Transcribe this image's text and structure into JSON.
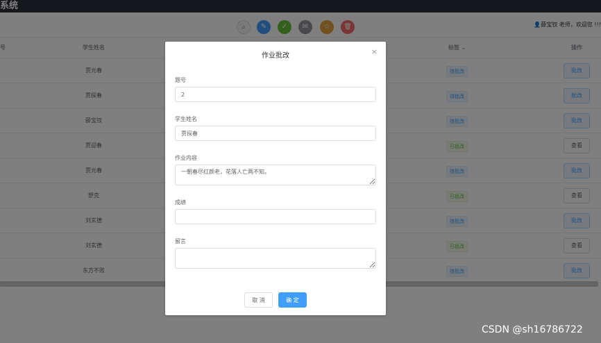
{
  "header": {
    "title": "系统"
  },
  "toolbar": {
    "buttons": [
      {
        "icon": "search-icon",
        "glyph": "⌕",
        "color": "#f5f5f5"
      },
      {
        "icon": "edit-icon",
        "glyph": "✎",
        "color": "#409eff"
      },
      {
        "icon": "check-icon",
        "glyph": "✓",
        "color": "#67c23a"
      },
      {
        "icon": "mail-icon",
        "glyph": "✉",
        "color": "#909399"
      },
      {
        "icon": "star-icon",
        "glyph": "☆",
        "color": "#e6a23c"
      },
      {
        "icon": "delete-icon",
        "glyph": "🗑",
        "color": "#f56c6c"
      }
    ],
    "user_text": "👤薛宝钗  老师，欢迎您 !!!"
  },
  "table": {
    "headers": {
      "id": "号",
      "name": "学生姓名",
      "tag": "标签 ⌄",
      "op": "操作"
    },
    "rows": [
      {
        "name": "贾元春",
        "tag": "待批改",
        "status": "pending",
        "op": "批改"
      },
      {
        "name": "贾探春",
        "tag": "待批改",
        "status": "pending",
        "op": "批改"
      },
      {
        "name": "薛宝钗",
        "tag": "待批改",
        "status": "pending",
        "op": "批改"
      },
      {
        "name": "贾迎春",
        "tag": "已批改",
        "status": "done",
        "op": "查看"
      },
      {
        "name": "贾元春",
        "tag": "待批改",
        "status": "pending",
        "op": "批改"
      },
      {
        "name": "舒克",
        "tag": "已批改",
        "status": "done",
        "op": "查看"
      },
      {
        "name": "刘玄德",
        "tag": "待批改",
        "status": "pending",
        "op": "批改"
      },
      {
        "name": "刘玄德",
        "tag": "已批改",
        "status": "done",
        "op": "查看"
      },
      {
        "name": "东方不败",
        "tag": "待批改",
        "status": "pending",
        "op": "批改"
      }
    ]
  },
  "dialog": {
    "title": "作业批改",
    "close_glyph": "×",
    "fields": {
      "qid_label": "题号",
      "qid_value": "2",
      "student_label": "学生姓名",
      "student_value": "贾探春",
      "content_label": "作业内容",
      "content_value": "一朝春尽红颜老，花落人亡两不知。",
      "score_label": "成绩",
      "score_value": "",
      "comment_label": "留言",
      "comment_value": ""
    },
    "cancel_label": "取 消",
    "confirm_label": "确 定"
  },
  "watermark": "CSDN @sh16786722"
}
